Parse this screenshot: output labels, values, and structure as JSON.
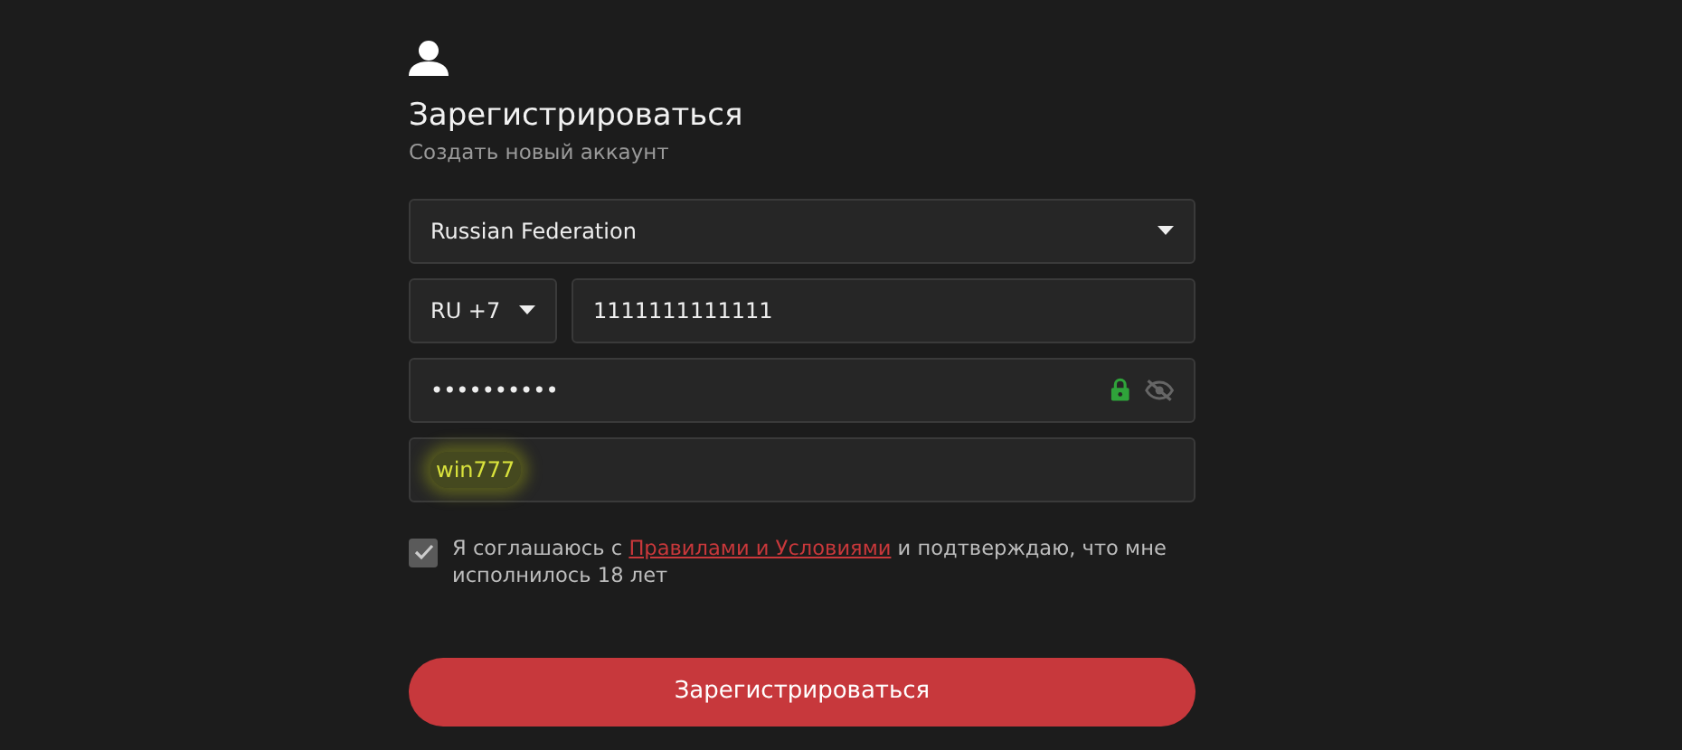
{
  "title": "Зарегистрироваться",
  "subtitle": "Создать новый аккаунт",
  "country": {
    "value": "Russian Federation"
  },
  "phone": {
    "code": "RU +7",
    "value": "1111111111111"
  },
  "password": {
    "value": "••••••••••",
    "secure": true
  },
  "promo": {
    "value": "win777",
    "highlighted": true
  },
  "agreement": {
    "checked": true,
    "text_before": "Я соглашаюсь с ",
    "link": "Правилами и Условиями",
    "text_after": " и подтверждаю, что мне исполнилось 18 лет"
  },
  "submit": "Зарегистрироваться"
}
